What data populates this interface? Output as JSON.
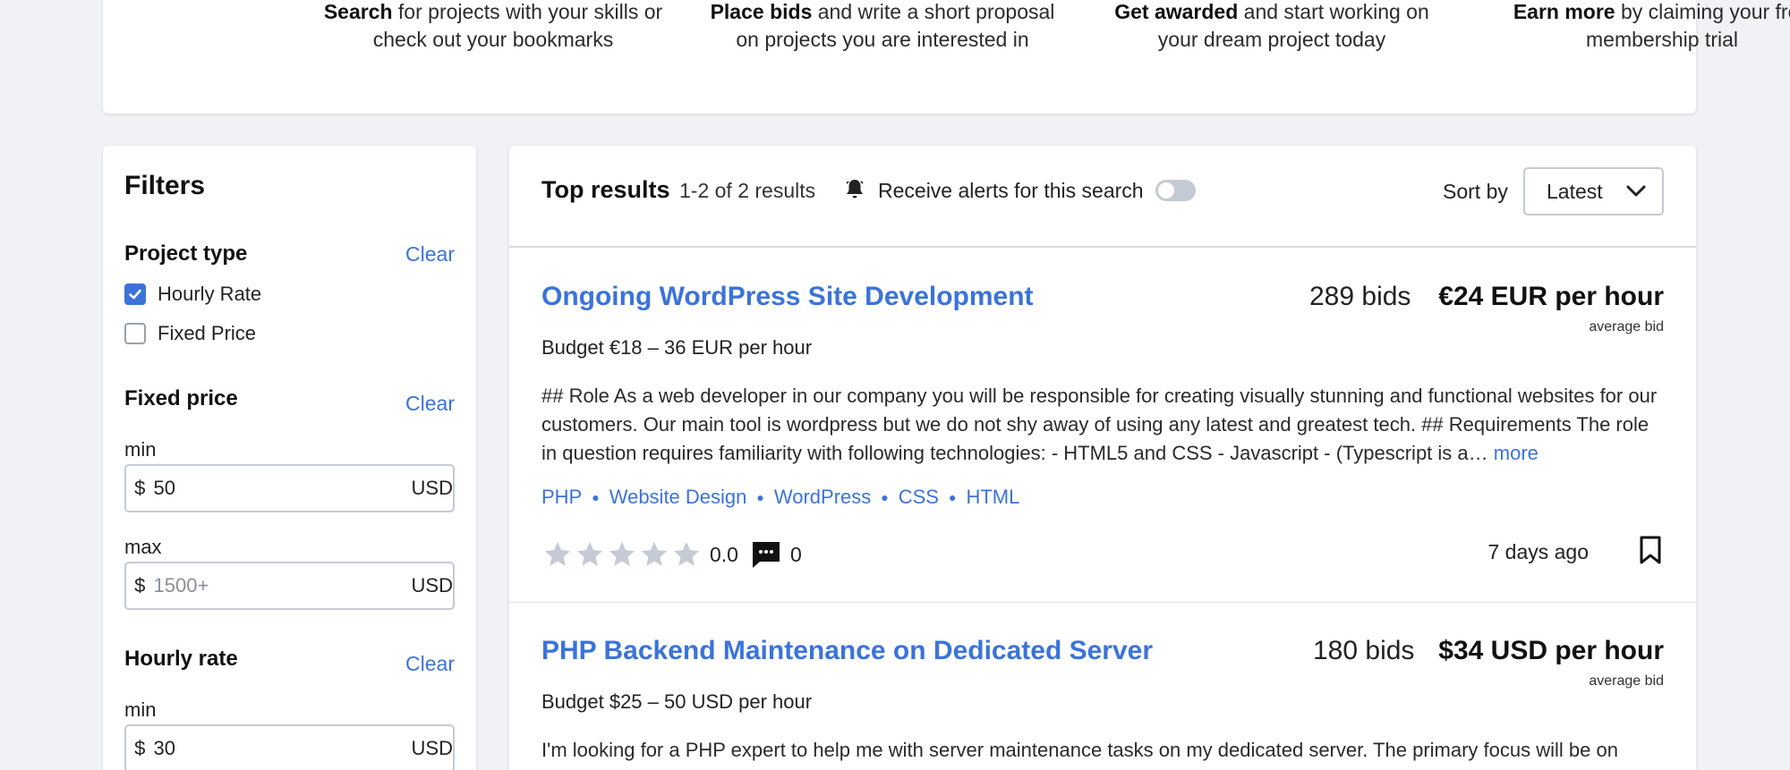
{
  "steps": [
    {
      "bold": "Search",
      "rest": " for projects with your skills or check out your bookmarks"
    },
    {
      "bold": "Place bids",
      "rest": " and write a short proposal on projects you are interested in"
    },
    {
      "bold": "Get awarded",
      "rest": " and start working on your dream project today"
    },
    {
      "bold": "Earn more",
      "rest": " by claiming your free membership trial"
    }
  ],
  "filters": {
    "title": "Filters",
    "project_type": {
      "title": "Project type",
      "clear": "Clear",
      "options": [
        {
          "label": "Hourly Rate",
          "checked": true
        },
        {
          "label": "Fixed Price",
          "checked": false
        }
      ]
    },
    "fixed_price": {
      "title": "Fixed price",
      "clear": "Clear",
      "min_label": "min",
      "min_value": "50",
      "max_label": "max",
      "max_placeholder": "1500+",
      "currency_symbol": "$",
      "unit": "USD"
    },
    "hourly_rate": {
      "title": "Hourly rate",
      "clear": "Clear",
      "min_label": "min",
      "min_value": "30",
      "currency_symbol": "$",
      "unit": "USD"
    }
  },
  "results": {
    "title": "Top results",
    "count": "1-2 of 2 results",
    "alert_label": "Receive alerts for this search",
    "alert_enabled": false,
    "sort_label": "Sort by",
    "sort_value": "Latest"
  },
  "projects": [
    {
      "title": "Ongoing WordPress Site Development",
      "bids": "289 bids",
      "price": "€24 EUR  per hour",
      "avg_label": "average bid",
      "budget": "Budget €18 – 36 EUR per hour",
      "description": "## Role As a web developer in our company you will be responsible for creating visually stunning and functional websites for our customers. Our main tool is wordpress but we do not shy away of using any latest and greatest tech. ## Requirements The role in question requires familiarity with following technologies: - HTML5 and CSS - Javascript - (Typescript is a…",
      "more": "more",
      "tags": [
        "PHP",
        "Website Design",
        "WordPress",
        "CSS",
        "HTML"
      ],
      "rating": "0.0",
      "reviews": "0",
      "age": "7 days ago"
    },
    {
      "title": "PHP Backend Maintenance on Dedicated Server",
      "bids": "180 bids",
      "price": "$34 USD per hour",
      "avg_label": "average bid",
      "budget": "Budget $25 – 50 USD per hour",
      "description": "I'm looking for a PHP expert to help me with server maintenance tasks on my dedicated server. The primary focus will be on"
    }
  ],
  "colors": {
    "accent": "#3b73d9",
    "background": "#f0f2f5",
    "star": "#c5cad3"
  }
}
